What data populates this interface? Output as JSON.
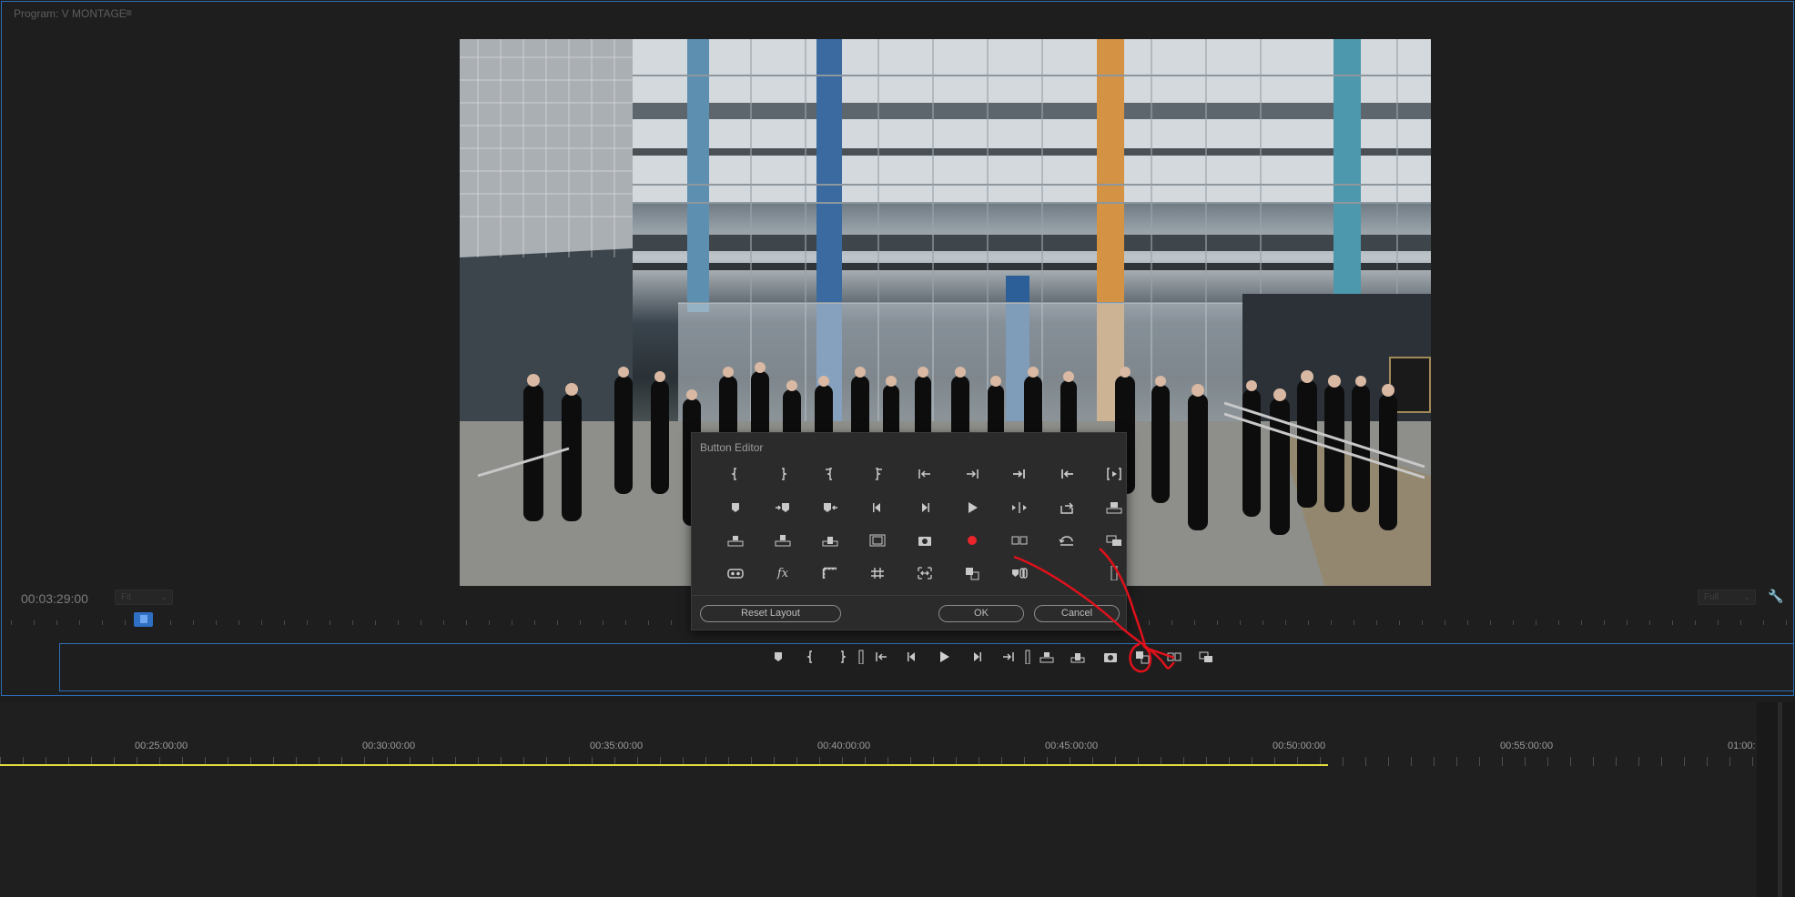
{
  "panel": {
    "title": "Program: V MONTAGE",
    "menu_icon": "hamburger-icon",
    "timecode": "00:03:29:00",
    "fit_label": "Fit",
    "resolution_label": "Full",
    "settings_icon": "wrench-icon"
  },
  "button_editor": {
    "title": "Button Editor",
    "reset_label": "Reset Layout",
    "ok_label": "OK",
    "cancel_label": "Cancel",
    "buttons": [
      [
        "mark-in",
        "mark-out",
        "mark-clip-in",
        "mark-clip-out",
        "go-to-in",
        "go-to-out",
        "go-to-next-edit",
        "go-to-previous-edit",
        "play-in-to-out"
      ],
      [
        "add-marker",
        "go-to-next-marker",
        "go-to-previous-marker",
        "step-back",
        "step-forward",
        "play",
        "play-around",
        "loop",
        "lift"
      ],
      [
        "insert",
        "extract",
        "overwrite",
        "safe-margins",
        "export-frame",
        "record",
        "multi-camera",
        "undo-comparison",
        "toggle-proxies"
      ],
      [
        "vr-video",
        "fx",
        "show-rulers",
        "show-guides",
        "snap-guides",
        "comparison-view",
        "trim-link",
        "",
        "spacer"
      ]
    ]
  },
  "transport": {
    "buttons": [
      "add-marker",
      "mark-in",
      "mark-out",
      "spacer",
      "go-to-in",
      "step-back",
      "play",
      "step-forward",
      "go-to-out",
      "spacer",
      "insert",
      "overwrite",
      "export-frame",
      "comparison-view",
      "multi-camera",
      "toggle-proxies"
    ]
  },
  "timeline": {
    "labels": [
      "00:25:00:00",
      "00:30:00:00",
      "00:35:00:00",
      "00:40:00:00",
      "00:45:00:00",
      "00:50:00:00",
      "00:55:00:00",
      "01:00:"
    ]
  },
  "colors": {
    "accent": "#2d6db5",
    "annotation": "#e0111b",
    "work_area": "#e4de3c",
    "record": "#e8262c"
  }
}
